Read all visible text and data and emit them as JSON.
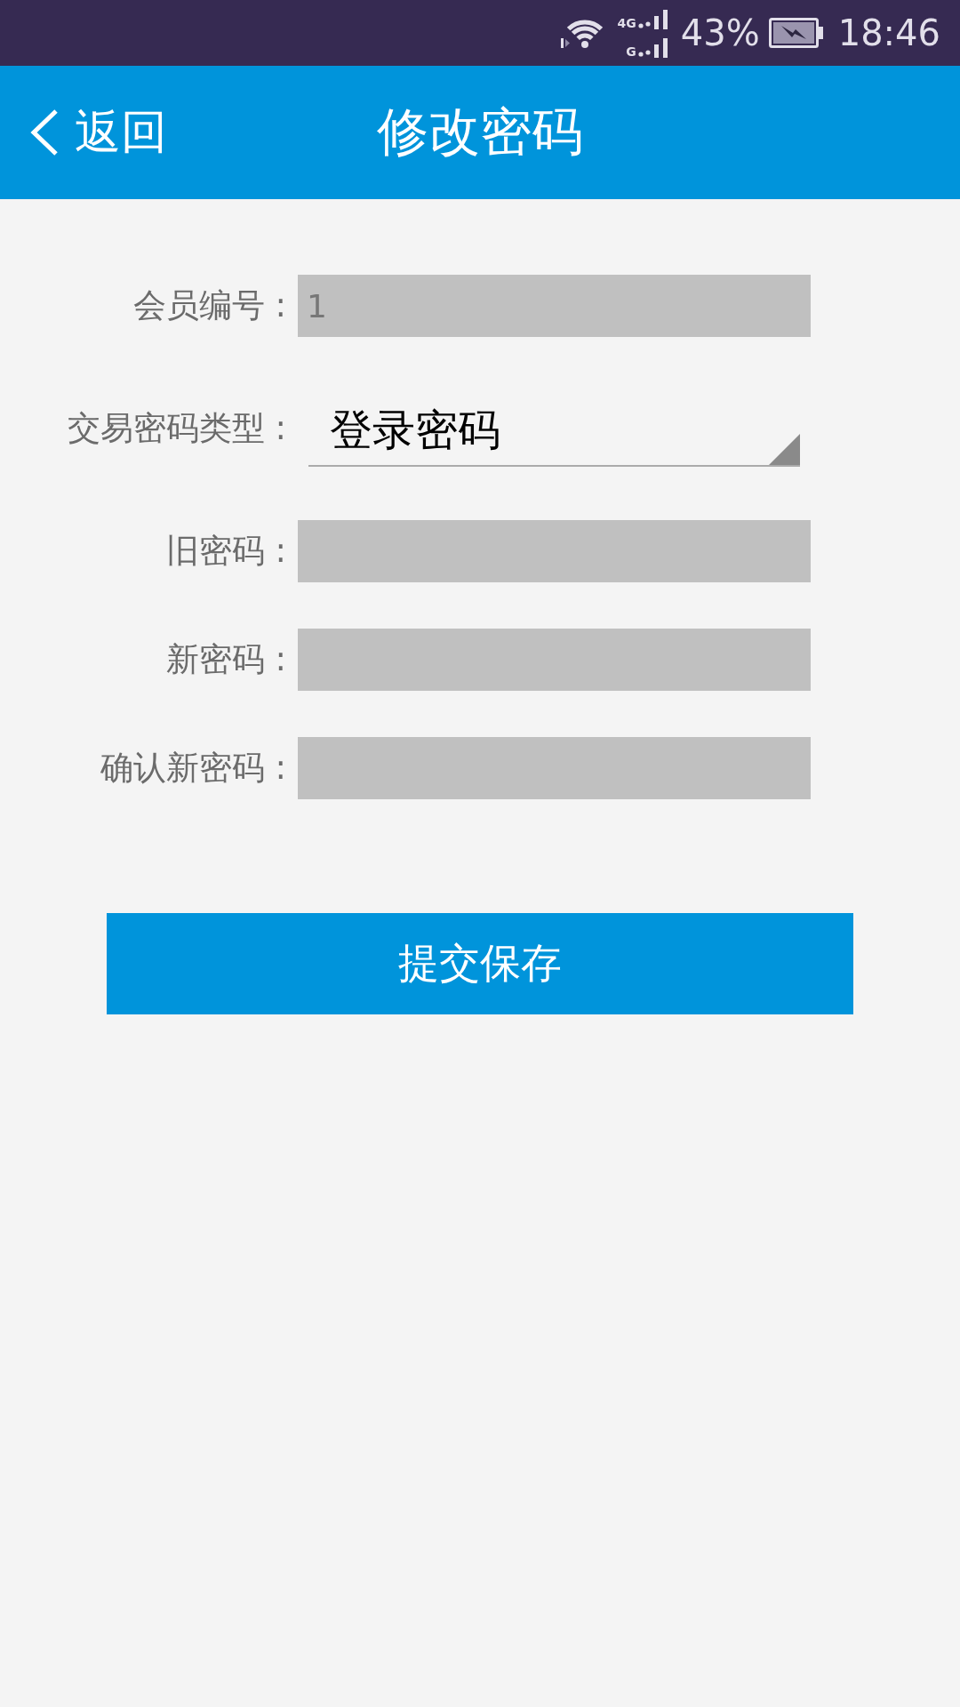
{
  "status_bar": {
    "network_labels": [
      "4G",
      "G"
    ],
    "battery_percent": "43%",
    "time": "18:46"
  },
  "header": {
    "back_label": "返回",
    "title": "修改密码"
  },
  "form": {
    "rows": [
      {
        "label": "会员编号 :",
        "kind": "input",
        "value": "1"
      },
      {
        "label": "交易密码类型 :",
        "kind": "select",
        "value": "登录密码"
      },
      {
        "label": "旧密码 :",
        "kind": "input"
      },
      {
        "label": "新密码 :",
        "kind": "input"
      },
      {
        "label": "确认新密码 :",
        "kind": "input"
      }
    ]
  },
  "submit_button": {
    "label": "提交保存"
  }
}
